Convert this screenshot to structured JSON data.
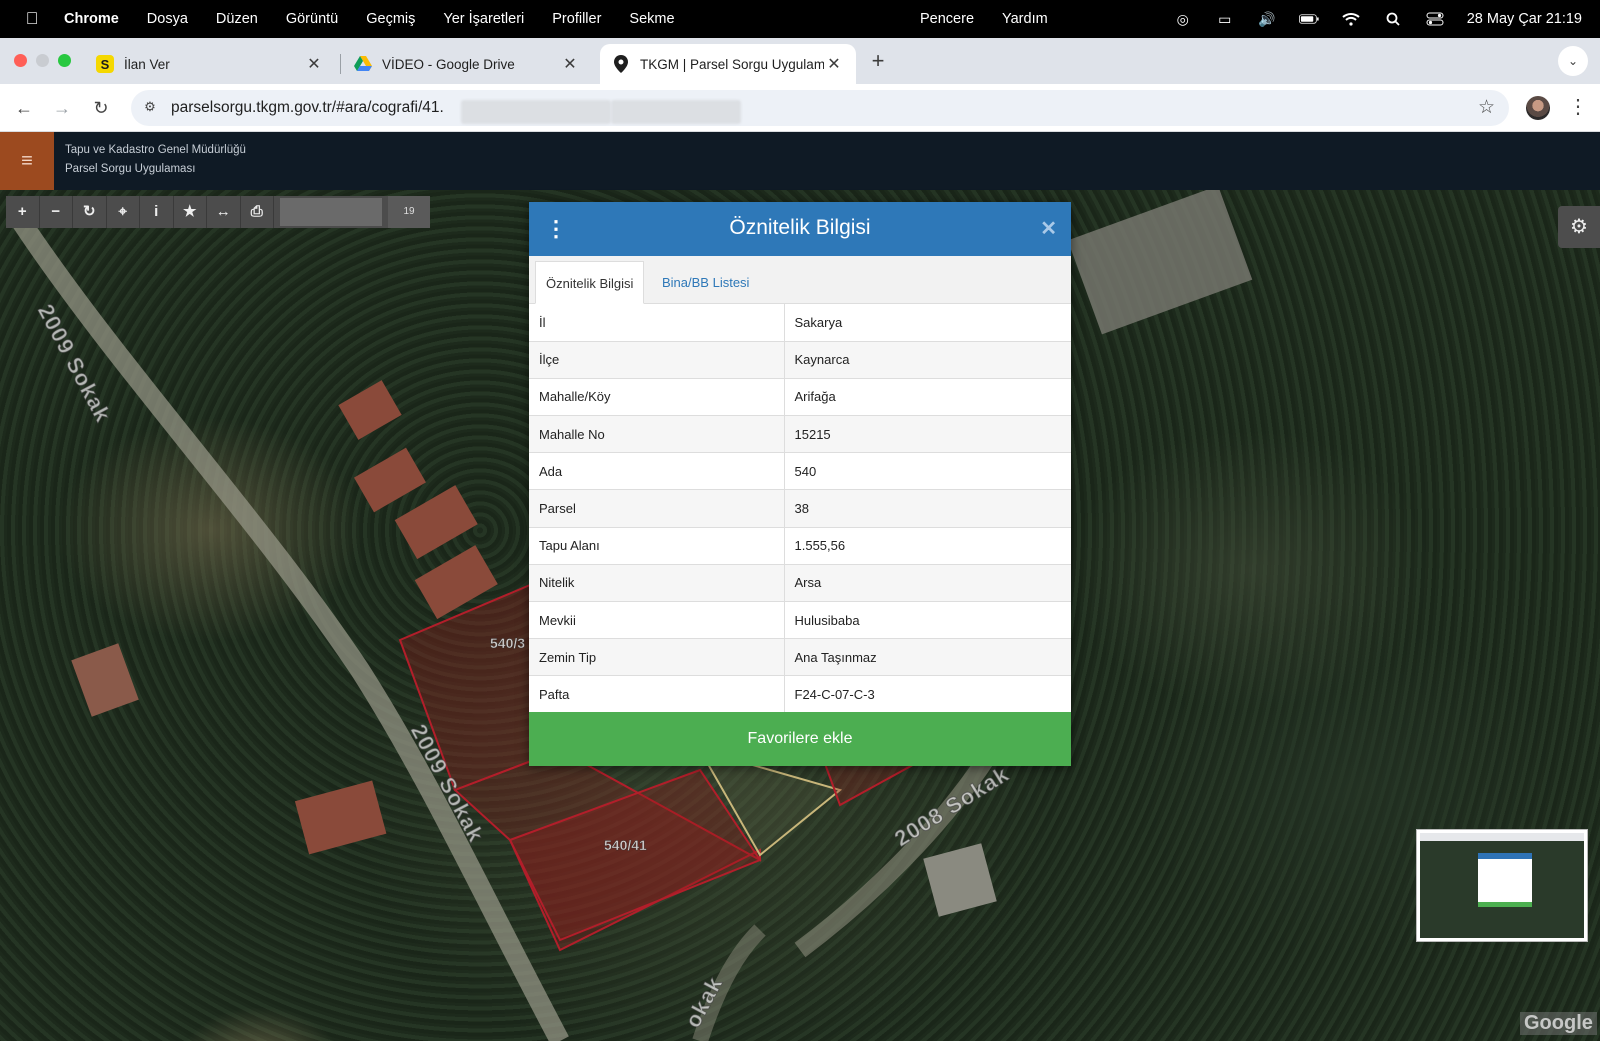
{
  "menubar": {
    "app": "Chrome",
    "items": [
      "Dosya",
      "Düzen",
      "Görüntü",
      "Geçmiş",
      "Yer İşaretleri",
      "Profiller",
      "Sekme"
    ],
    "items_mid": [
      "Pencere",
      "Yardım"
    ],
    "clock": "28 May Çar  21:19"
  },
  "tabs": [
    {
      "title": "İlan Ver",
      "favicon": "S"
    },
    {
      "title": "VİDEO - Google Drive",
      "favicon": "drive-icon"
    },
    {
      "title": "TKGM | Parsel Sorgu Uygulam",
      "favicon": "map-pin-icon"
    }
  ],
  "toolbar": {
    "url": "parselsorgu.tkgm.gov.tr/#ara/cografi/41."
  },
  "app": {
    "title_line1": "Tapu ve Kadastro Genel Müdürlüğü",
    "title_line2": "Parsel Sorgu Uygulaması",
    "zoom": "19"
  },
  "map": {
    "streets": [
      "2009 Sokak",
      "2009 Sokak",
      "2008 Sokak",
      "okak"
    ],
    "parcels": [
      "540/3",
      "540/41"
    ],
    "logo": "Google"
  },
  "dialog": {
    "title": "Öznitelik Bilgisi",
    "tabs": [
      "Öznitelik Bilgisi",
      "Bina/BB Listesi"
    ],
    "rows": [
      {
        "key": "İl",
        "value": "Sakarya"
      },
      {
        "key": "İlçe",
        "value": "Kaynarca"
      },
      {
        "key": "Mahalle/Köy",
        "value": "Arifağa"
      },
      {
        "key": "Mahalle No",
        "value": "15215"
      },
      {
        "key": "Ada",
        "value": "540"
      },
      {
        "key": "Parsel",
        "value": "38"
      },
      {
        "key": "Tapu Alanı",
        "value": "1.555,56"
      },
      {
        "key": "Nitelik",
        "value": "Arsa"
      },
      {
        "key": "Mevkii",
        "value": "Hulusibaba"
      },
      {
        "key": "Zemin Tip",
        "value": "Ana Taşınmaz"
      },
      {
        "key": "Pafta",
        "value": "F24-C-07-C-3"
      }
    ],
    "button": "Favorilere ekle"
  },
  "colors": {
    "dialog_header": "#2e78b8",
    "favorite_button": "#4cae51",
    "menu_toggle": "#9c4a1f"
  }
}
